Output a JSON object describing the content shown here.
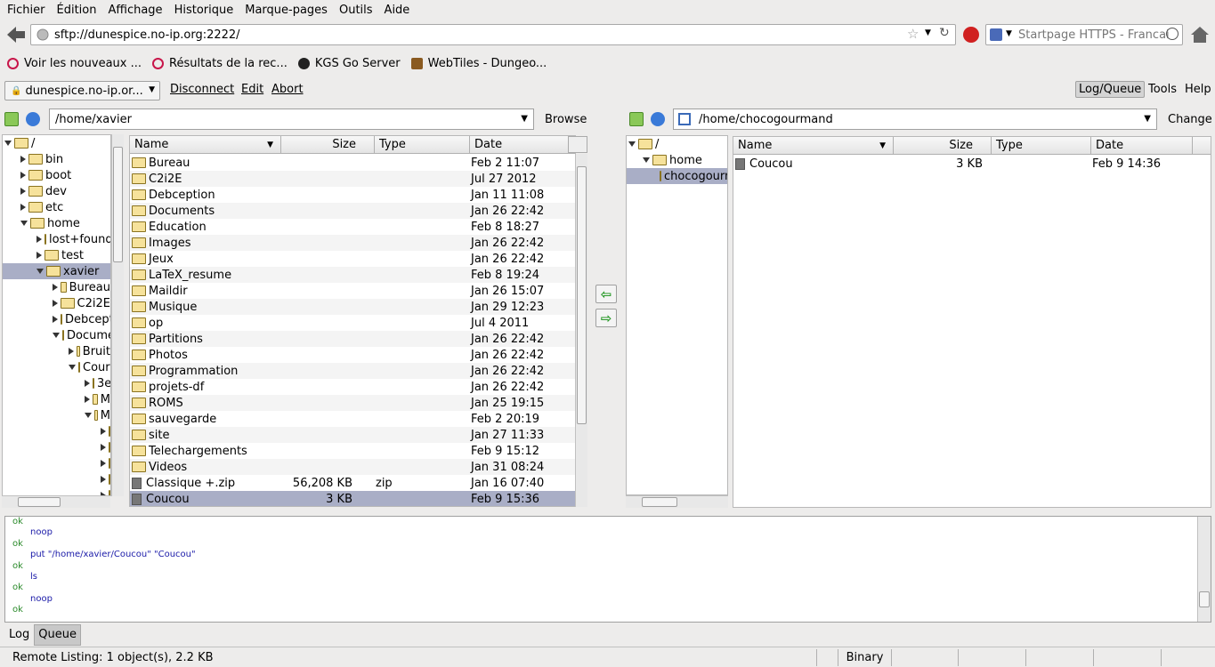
{
  "menu": [
    "Fichier",
    "Édition",
    "Affichage",
    "Historique",
    "Marque-pages",
    "Outils",
    "Aide"
  ],
  "url": "sftp://dunespice.no-ip.org:2222/",
  "search_placeholder": "Startpage HTTPS - Francai",
  "bookmarks": [
    {
      "label": "Voir les nouveaux ...",
      "color": "#c8164a"
    },
    {
      "label": "Résultats de la rec...",
      "color": "#c8164a"
    },
    {
      "label": "KGS Go Server",
      "color": "#222222"
    },
    {
      "label": "WebTiles - Dungeo...",
      "color": "#8a5a20"
    }
  ],
  "toolbar": {
    "site": "dunespice.no-ip.or...",
    "disconnect": "Disconnect",
    "edit": "Edit",
    "abort": "Abort",
    "logqueue": "Log/Queue",
    "tools": "Tools",
    "help": "Help"
  },
  "local": {
    "path": "/home/xavier",
    "browse": "Browse",
    "tree": [
      {
        "label": "/",
        "level": 0,
        "state": "open"
      },
      {
        "label": "bin",
        "level": 1,
        "state": "closed"
      },
      {
        "label": "boot",
        "level": 1,
        "state": "closed"
      },
      {
        "label": "dev",
        "level": 1,
        "state": "closed"
      },
      {
        "label": "etc",
        "level": 1,
        "state": "closed"
      },
      {
        "label": "home",
        "level": 1,
        "state": "open"
      },
      {
        "label": "lost+found",
        "level": 2,
        "state": "closed"
      },
      {
        "label": "test",
        "level": 2,
        "state": "closed"
      },
      {
        "label": "xavier",
        "level": 2,
        "state": "open",
        "selected": true
      },
      {
        "label": "Bureau",
        "level": 3,
        "state": "closed"
      },
      {
        "label": "C2i2E",
        "level": 3,
        "state": "closed"
      },
      {
        "label": "Debception",
        "level": 3,
        "state": "closed"
      },
      {
        "label": "Documents",
        "level": 3,
        "state": "open"
      },
      {
        "label": "Bruit",
        "level": 4,
        "state": "closed"
      },
      {
        "label": "Cours",
        "level": 4,
        "state": "open"
      },
      {
        "label": "3e",
        "level": 5,
        "state": "closed"
      },
      {
        "label": "M",
        "level": 5,
        "state": "closed"
      },
      {
        "label": "M",
        "level": 5,
        "state": "open"
      },
      {
        "label": "",
        "level": 6,
        "state": "closed"
      },
      {
        "label": "",
        "level": 6,
        "state": "closed"
      },
      {
        "label": "",
        "level": 6,
        "state": "closed"
      },
      {
        "label": "",
        "level": 6,
        "state": "closed"
      },
      {
        "label": "",
        "level": 6,
        "state": "closed"
      }
    ],
    "columns": [
      "Name",
      "Size",
      "Type",
      "Date"
    ],
    "files": [
      {
        "name": "Bureau",
        "size": "",
        "type": "",
        "date": "Feb 2 11:07",
        "kind": "folder"
      },
      {
        "name": "C2i2E",
        "size": "",
        "type": "",
        "date": "Jul 27 2012",
        "kind": "folder"
      },
      {
        "name": "Debception",
        "size": "",
        "type": "",
        "date": "Jan 11 11:08",
        "kind": "folder"
      },
      {
        "name": "Documents",
        "size": "",
        "type": "",
        "date": "Jan 26 22:42",
        "kind": "folder"
      },
      {
        "name": "Education",
        "size": "",
        "type": "",
        "date": "Feb 8 18:27",
        "kind": "folder"
      },
      {
        "name": "Images",
        "size": "",
        "type": "",
        "date": "Jan 26 22:42",
        "kind": "folder"
      },
      {
        "name": "Jeux",
        "size": "",
        "type": "",
        "date": "Jan 26 22:42",
        "kind": "folder"
      },
      {
        "name": "LaTeX_resume",
        "size": "",
        "type": "",
        "date": "Feb 8 19:24",
        "kind": "folder"
      },
      {
        "name": "Maildir",
        "size": "",
        "type": "",
        "date": "Jan 26 15:07",
        "kind": "folder"
      },
      {
        "name": "Musique",
        "size": "",
        "type": "",
        "date": "Jan 29 12:23",
        "kind": "folder"
      },
      {
        "name": "op",
        "size": "",
        "type": "",
        "date": "Jul 4 2011",
        "kind": "folder"
      },
      {
        "name": "Partitions",
        "size": "",
        "type": "",
        "date": "Jan 26 22:42",
        "kind": "folder"
      },
      {
        "name": "Photos",
        "size": "",
        "type": "",
        "date": "Jan 26 22:42",
        "kind": "folder"
      },
      {
        "name": "Programmation",
        "size": "",
        "type": "",
        "date": "Jan 26 22:42",
        "kind": "folder"
      },
      {
        "name": "projets-df",
        "size": "",
        "type": "",
        "date": "Jan 26 22:42",
        "kind": "folder"
      },
      {
        "name": "ROMS",
        "size": "",
        "type": "",
        "date": "Jan 25 19:15",
        "kind": "folder"
      },
      {
        "name": "sauvegarde",
        "size": "",
        "type": "",
        "date": "Feb 2 20:19",
        "kind": "folder"
      },
      {
        "name": "site",
        "size": "",
        "type": "",
        "date": "Jan 27 11:33",
        "kind": "folder"
      },
      {
        "name": "Telechargements",
        "size": "",
        "type": "",
        "date": "Feb 9 15:12",
        "kind": "folder"
      },
      {
        "name": "Videos",
        "size": "",
        "type": "",
        "date": "Jan 31 08:24",
        "kind": "folder"
      },
      {
        "name": "Classique +.zip",
        "size": "56,208 KB",
        "type": "zip",
        "date": "Jan 16 07:40",
        "kind": "zip"
      },
      {
        "name": "Coucou",
        "size": "3 KB",
        "type": "",
        "date": "Feb 9 15:36",
        "kind": "file",
        "selected": true
      }
    ]
  },
  "remote": {
    "path": "/home/chocogourmand",
    "change": "Change",
    "tree": [
      {
        "label": "/",
        "level": 0,
        "state": "open"
      },
      {
        "label": "home",
        "level": 1,
        "state": "open"
      },
      {
        "label": "chocogourmand",
        "level": 2,
        "state": "none",
        "selected": true
      }
    ],
    "columns": [
      "Name",
      "Size",
      "Type",
      "Date"
    ],
    "files": [
      {
        "name": "Coucou",
        "size": "3 KB",
        "type": "",
        "date": "Feb 9 14:36",
        "kind": "file"
      }
    ]
  },
  "log": [
    {
      "kind": "ok",
      "text": "ok"
    },
    {
      "kind": "cmd",
      "text": "noop"
    },
    {
      "kind": "ok",
      "text": "ok"
    },
    {
      "kind": "cmd",
      "text": "put \"/home/xavier/Coucou\" \"Coucou\""
    },
    {
      "kind": "ok",
      "text": "ok"
    },
    {
      "kind": "cmd",
      "text": "ls"
    },
    {
      "kind": "ok",
      "text": "ok"
    },
    {
      "kind": "cmd",
      "text": "noop"
    },
    {
      "kind": "ok",
      "text": "ok"
    }
  ],
  "tabs": {
    "log": "Log",
    "queue": "Queue"
  },
  "status": {
    "text": "Remote Listing: 1 object(s), 2.2 KB",
    "mode": "Binary"
  }
}
